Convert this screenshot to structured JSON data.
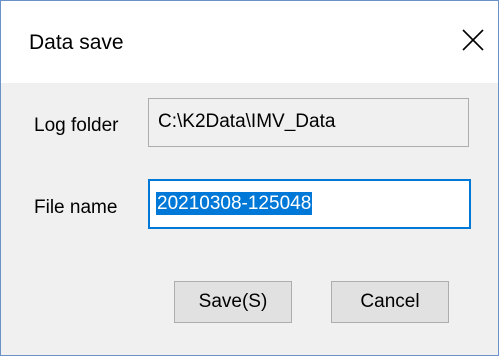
{
  "window": {
    "title": "Data save",
    "close_icon": "close-icon"
  },
  "form": {
    "log_folder": {
      "label": "Log folder",
      "value": "C:\\K2Data\\IMV_Data"
    },
    "file_name": {
      "label": "File name",
      "value": "20210308-125048"
    }
  },
  "buttons": {
    "save_label": "Save(S)",
    "cancel_label": "Cancel"
  },
  "colors": {
    "selection": "#0078d7",
    "dialog_background": "#f0f0f0",
    "title_background": "#ffffff",
    "button_background": "#e1e1e1"
  }
}
